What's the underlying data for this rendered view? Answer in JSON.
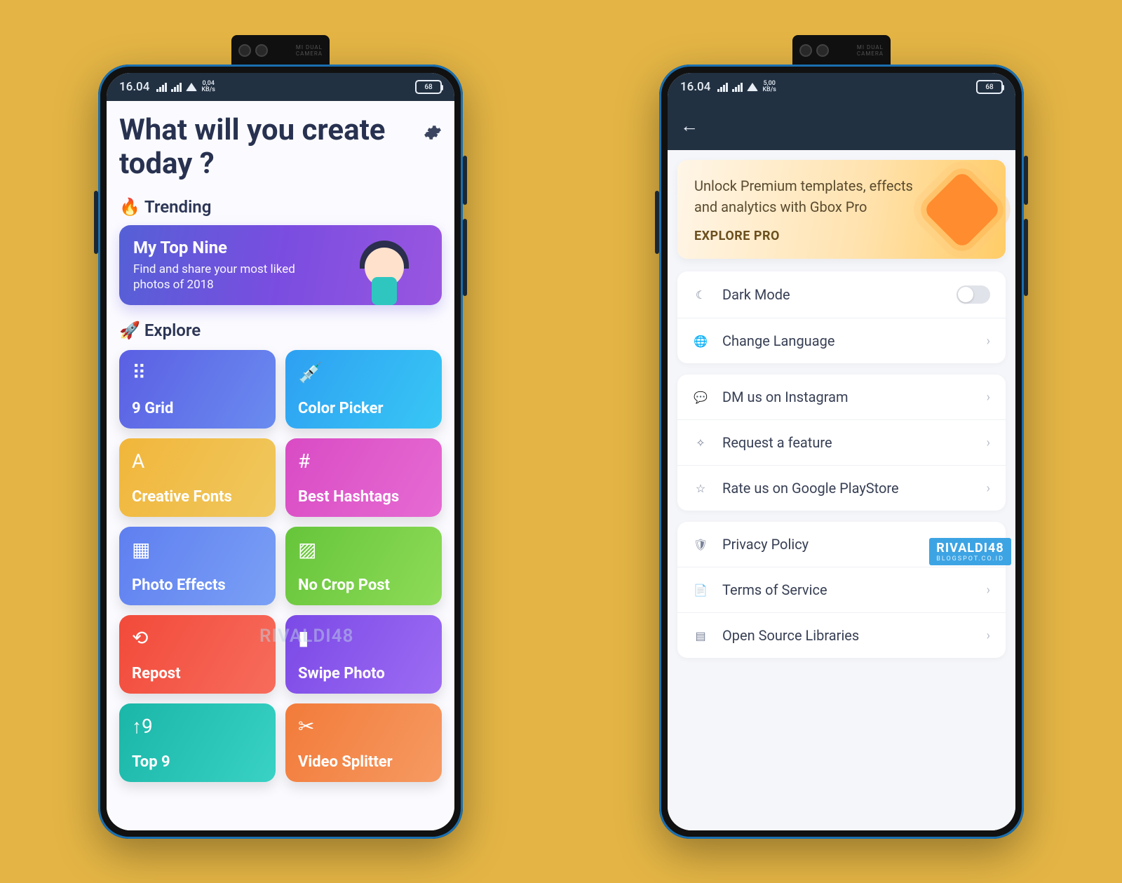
{
  "status": {
    "time": "16.04",
    "kbs1": "0,04",
    "kbs2": "5,00",
    "kbs_unit": "KB/s",
    "battery": "68"
  },
  "left": {
    "headline": "What will you create today ?",
    "trending_label": "Trending",
    "trending_emoji": "🔥",
    "trend": {
      "title": "My Top Nine",
      "subtitle": "Find and share your most liked photos of 2018"
    },
    "explore_label": "Explore",
    "explore_emoji": "🚀",
    "tiles": [
      {
        "label": "9 Grid",
        "icon": "⠿",
        "cls": "g-9grid",
        "name": "tile-9grid"
      },
      {
        "label": "Color Picker",
        "icon": "💉",
        "cls": "g-color",
        "name": "tile-color-picker"
      },
      {
        "label": "Creative Fonts",
        "icon": "A",
        "cls": "g-fonts",
        "name": "tile-creative-fonts"
      },
      {
        "label": "Best Hashtags",
        "icon": "#",
        "cls": "g-hash",
        "name": "tile-best-hashtags"
      },
      {
        "label": "Photo Effects",
        "icon": "▦",
        "cls": "g-photo",
        "name": "tile-photo-effects"
      },
      {
        "label": "No Crop Post",
        "icon": "▨",
        "cls": "g-nocrop",
        "name": "tile-no-crop-post"
      },
      {
        "label": "Repost",
        "icon": "⟲",
        "cls": "g-repost",
        "name": "tile-repost"
      },
      {
        "label": "Swipe Photo",
        "icon": "▮",
        "cls": "g-swipe",
        "name": "tile-swipe-photo"
      },
      {
        "label": "Top 9",
        "icon": "↑9",
        "cls": "g-top9",
        "name": "tile-top-9"
      },
      {
        "label": "Video Splitter",
        "icon": "✂",
        "cls": "g-video",
        "name": "tile-video-splitter"
      }
    ]
  },
  "right": {
    "promo": {
      "line": "Unlock Premium templates, effects and analytics with Gbox Pro",
      "cta": "EXPLORE PRO"
    },
    "groups": [
      {
        "rows": [
          {
            "label": "Dark Mode",
            "icon": "☾",
            "type": "toggle",
            "name": "row-dark-mode"
          },
          {
            "label": "Change Language",
            "icon": "🌐",
            "type": "nav",
            "name": "row-change-language"
          }
        ]
      },
      {
        "rows": [
          {
            "label": "DM us on Instagram",
            "icon": "💬",
            "type": "nav",
            "name": "row-dm-instagram"
          },
          {
            "label": "Request a feature",
            "icon": "✧",
            "type": "nav",
            "name": "row-request-feature"
          },
          {
            "label": "Rate us on Google PlayStore",
            "icon": "☆",
            "type": "nav",
            "name": "row-rate-playstore"
          }
        ]
      },
      {
        "rows": [
          {
            "label": "Privacy Policy",
            "icon": "🛡",
            "type": "nav",
            "name": "row-privacy-policy"
          },
          {
            "label": "Terms of Service",
            "icon": "📄",
            "type": "nav",
            "name": "row-terms-of-service"
          },
          {
            "label": "Open Source Libraries",
            "icon": "▤",
            "type": "nav",
            "name": "row-open-source"
          }
        ]
      }
    ]
  },
  "watermark": {
    "text": "RIVALDI48",
    "sub": "BLOGSPOT.CO.ID"
  }
}
